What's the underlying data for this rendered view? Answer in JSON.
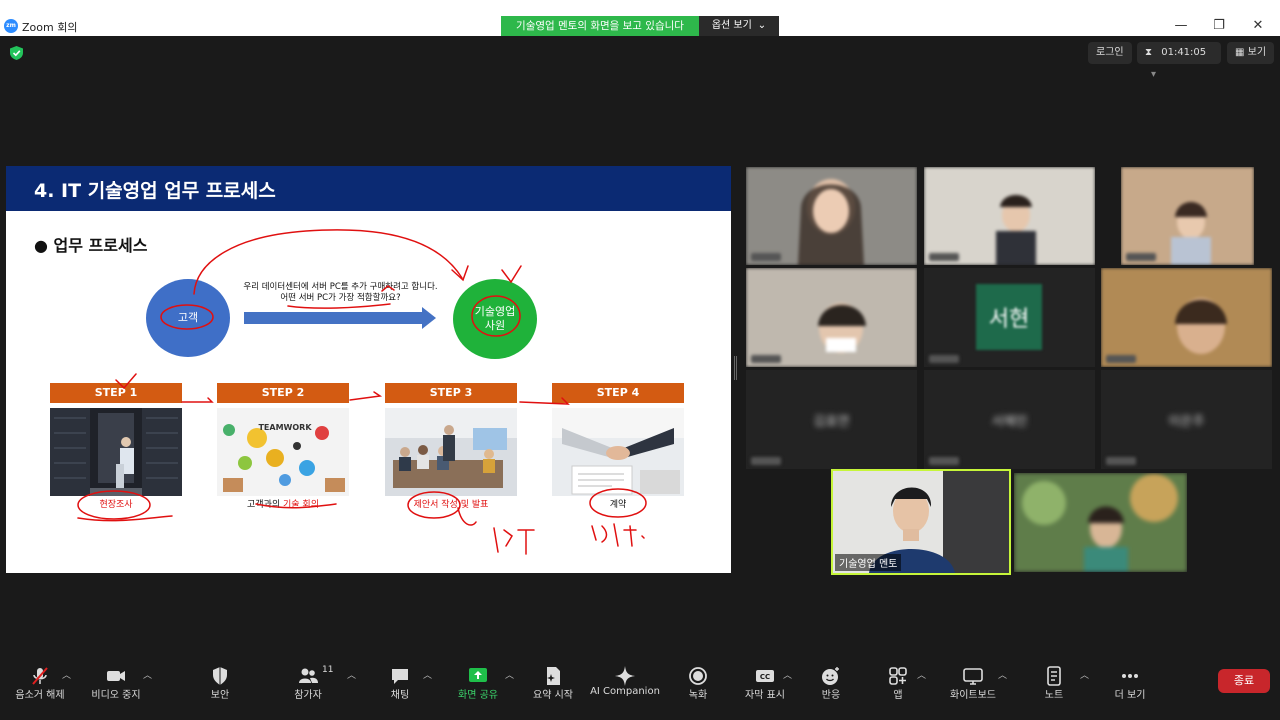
{
  "window": {
    "title": "Zoom 회의",
    "logo": "zm"
  },
  "share_banner": {
    "text": "기술영업 멘토의 화면을 보고 있습니다",
    "options": "옵션 보기"
  },
  "topbar": {
    "login": "로그인",
    "timer": "01:41:05",
    "view": "보기"
  },
  "slide": {
    "title": "4. IT 기술영업 업무 프로세스",
    "bullet": "● 업무 프로세스",
    "customer": "고객",
    "sales": "기술영업 사원",
    "question_line1": "우리 데이터센터에 서버 PC를 추가 구매하려고 합니다.",
    "question_line2": "어떤 서버 PC가 가장 적합할까요?",
    "steps": [
      {
        "label": "STEP 1",
        "caption": "현장조사",
        "caption_red": ""
      },
      {
        "label": "STEP 2",
        "caption": "고객과의 ",
        "caption_red": "기술 회의"
      },
      {
        "label": "STEP 3",
        "caption": "",
        "caption_red": "제안서 작성 및 발표"
      },
      {
        "label": "STEP 4",
        "caption": "계약",
        "caption_red": ""
      }
    ],
    "photo_text": "TEAMWORK"
  },
  "participants": {
    "grid_names": [
      "김효연",
      "서혜민",
      "이은주"
    ],
    "avatar_initials": "서현",
    "mentor_name": "기술영업 멘토"
  },
  "toolbar": {
    "mute": "음소거 해제",
    "video": "비디오 중지",
    "security": "보안",
    "participants": "참가자",
    "participants_count": "11",
    "chat": "채팅",
    "share": "화면 공유",
    "summary": "요약 시작",
    "ai": "AI Companion",
    "record": "녹화",
    "captions": "자막 표시",
    "reactions": "반응",
    "apps": "앱",
    "whiteboard": "화이트보드",
    "notes": "노트",
    "more": "더 보기",
    "end": "종료",
    "cc": "CC"
  },
  "colors": {
    "share_green": "#2eb84b",
    "slide_header": "#0b2a73",
    "step_orange": "#d35b12",
    "end_red": "#c8262b",
    "highlight": "#c6f53a"
  }
}
